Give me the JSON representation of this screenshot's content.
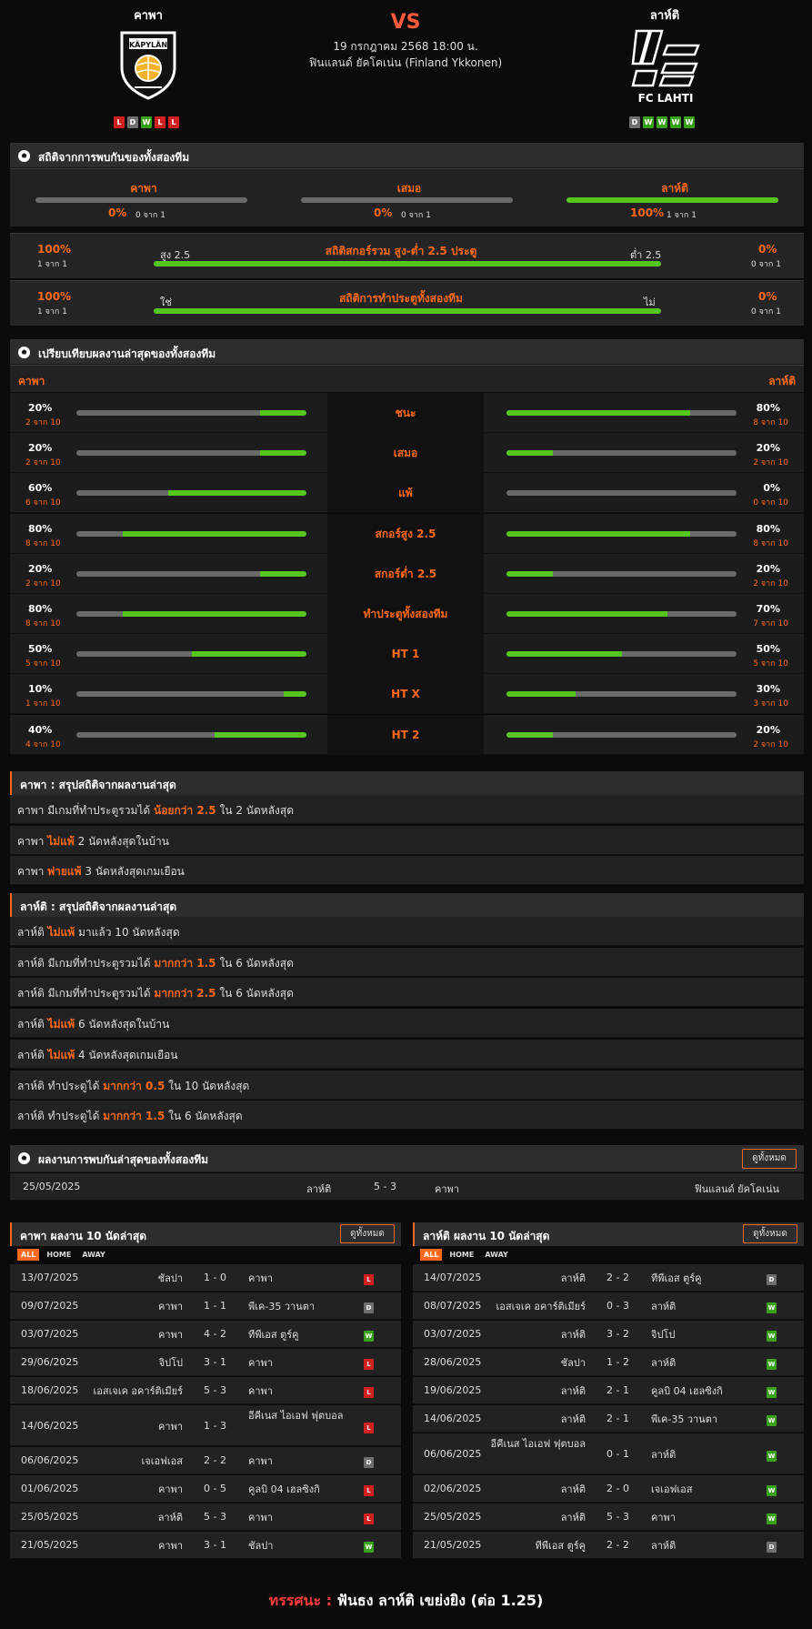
{
  "match": {
    "home": "คาพา",
    "away": "ลาห์ติ",
    "vs": "VS",
    "datetime": "19 กรกฎาคม 2568 18:00 น.",
    "league": "ฟินแลนด์ ยัคโคเน่น (Finland Ykkonen)",
    "home_logo_text": "KÄPYLÄN",
    "away_logo_text": "FC LAHTI",
    "home_form": [
      "L",
      "D",
      "W",
      "L",
      "L"
    ],
    "away_form": [
      "D",
      "W",
      "W",
      "W",
      "W"
    ]
  },
  "h2h": {
    "title": "สถิติจากการพบกันของทั้งสองทีม",
    "cols": [
      {
        "label": "คาพา",
        "pct": "0%",
        "count": "0 จาก 1",
        "fill": 0
      },
      {
        "label": "เสมอ",
        "pct": "0%",
        "count": "0 จาก 1",
        "fill": 0
      },
      {
        "label": "ลาห์ติ",
        "pct": "100%",
        "count": "1 จาก 1",
        "fill": 1
      }
    ],
    "ou": {
      "title": "สถิติสกอร์รวม สูง-ต่ำ 2.5 ประตู",
      "left_tag": "สูง 2.5",
      "right_tag": "ต่ำ 2.5",
      "left_pct": "100%",
      "left_count": "1 จาก 1",
      "right_pct": "0%",
      "right_count": "0 จาก 1",
      "fill": 1
    },
    "btts": {
      "title": "สถิติการทำประตูทั้งสองทีม",
      "left_tag": "ใช่",
      "right_tag": "ไม่",
      "left_pct": "100%",
      "left_count": "1 จาก 1",
      "right_pct": "0%",
      "right_count": "0 จาก 1",
      "fill": 1
    }
  },
  "compare": {
    "title": "เปรียบเทียบผลงานล่าสุดของทั้งสองทีม",
    "home": "คาพา",
    "away": "ลาห์ติ",
    "rows": [
      {
        "label": "ชนะ",
        "h_pct": "20%",
        "h_cnt": "2 จาก 10",
        "h": 0.2,
        "a_pct": "80%",
        "a_cnt": "8 จาก 10",
        "a": 0.8
      },
      {
        "label": "เสมอ",
        "h_pct": "20%",
        "h_cnt": "2 จาก 10",
        "h": 0.2,
        "a_pct": "20%",
        "a_cnt": "2 จาก 10",
        "a": 0.2
      },
      {
        "label": "แพ้",
        "h_pct": "60%",
        "h_cnt": "6 จาก 10",
        "h": 0.6,
        "a_pct": "0%",
        "a_cnt": "0 จาก 10",
        "a": 0
      },
      {
        "label": "สกอร์สูง 2.5",
        "h_pct": "80%",
        "h_cnt": "8 จาก 10",
        "h": 0.8,
        "a_pct": "80%",
        "a_cnt": "8 จาก 10",
        "a": 0.8
      },
      {
        "label": "สกอร์ต่ำ 2.5",
        "h_pct": "20%",
        "h_cnt": "2 จาก 10",
        "h": 0.2,
        "a_pct": "20%",
        "a_cnt": "2 จาก 10",
        "a": 0.2
      },
      {
        "label": "ทำประตูทั้งสองทีม",
        "h_pct": "80%",
        "h_cnt": "8 จาก 10",
        "h": 0.8,
        "a_pct": "70%",
        "a_cnt": "7 จาก 10",
        "a": 0.7
      },
      {
        "label": "HT 1",
        "h_pct": "50%",
        "h_cnt": "5 จาก 10",
        "h": 0.5,
        "a_pct": "50%",
        "a_cnt": "5 จาก 10",
        "a": 0.5
      },
      {
        "label": "HT X",
        "h_pct": "10%",
        "h_cnt": "1 จาก 10",
        "h": 0.1,
        "a_pct": "30%",
        "a_cnt": "3 จาก 10",
        "a": 0.3
      },
      {
        "label": "HT 2",
        "h_pct": "40%",
        "h_cnt": "4 จาก 10",
        "h": 0.4,
        "a_pct": "20%",
        "a_cnt": "2 จาก 10",
        "a": 0.2
      }
    ]
  },
  "home_summary": {
    "title": "คาพา : สรุปสถิติจากผลงานล่าสุด",
    "rows": [
      [
        {
          "t": "คาพา มีเกมที่ทำประตูรวมได้ "
        },
        {
          "t": "น้อยกว่า 2.5",
          "hl": true
        },
        {
          "t": " ใน 2 นัดหลังสุด"
        }
      ],
      [
        {
          "t": "คาพา "
        },
        {
          "t": "ไม่แพ้",
          "hl": true
        },
        {
          "t": " 2 นัดหลังสุดในบ้าน"
        }
      ],
      [
        {
          "t": "คาพา "
        },
        {
          "t": "พ่ายแพ้",
          "hl": true
        },
        {
          "t": " 3 นัดหลังสุดเกมเยือน"
        }
      ]
    ]
  },
  "away_summary": {
    "title": "ลาห์ติ : สรุปสถิติจากผลงานล่าสุด",
    "rows": [
      [
        {
          "t": "ลาห์ติ "
        },
        {
          "t": "ไม่แพ้",
          "hl": true
        },
        {
          "t": " มาแล้ว 10 นัดหลังสุด"
        }
      ],
      [
        {
          "t": "ลาห์ติ มีเกมที่ทำประตูรวมได้ "
        },
        {
          "t": "มากกว่า 1.5",
          "hl": true
        },
        {
          "t": " ใน 6 นัดหลังสุด"
        }
      ],
      [
        {
          "t": "ลาห์ติ มีเกมที่ทำประตูรวมได้ "
        },
        {
          "t": "มากกว่า 2.5",
          "hl": true
        },
        {
          "t": " ใน 6 นัดหลังสุด"
        }
      ],
      [
        {
          "t": "ลาห์ติ "
        },
        {
          "t": "ไม่แพ้",
          "hl": true
        },
        {
          "t": " 6 นัดหลังสุดในบ้าน"
        }
      ],
      [
        {
          "t": "ลาห์ติ "
        },
        {
          "t": "ไม่แพ้",
          "hl": true
        },
        {
          "t": " 4 นัดหลังสุดเกมเยือน"
        }
      ],
      [
        {
          "t": "ลาห์ติ ทำประตูได้ "
        },
        {
          "t": "มากกว่า 0.5",
          "hl": true
        },
        {
          "t": " ใน 10 นัดหลังสุด"
        }
      ],
      [
        {
          "t": "ลาห์ติ ทำประตูได้ "
        },
        {
          "t": "มากกว่า 1.5",
          "hl": true
        },
        {
          "t": " ใน 6 นัดหลังสุด"
        }
      ]
    ]
  },
  "h2h_results": {
    "title": "ผลงานการพบกันล่าสุดของทั้งสองทีม",
    "view_all": "ดูทั้งหมด",
    "rows": [
      {
        "date": "25/05/2025",
        "home": "ลาห์ติ",
        "score": "5 - 3",
        "away": "คาพา",
        "league": "ฟินแลนด์ ยัคโคเน่น"
      }
    ]
  },
  "home_last10": {
    "title": "คาพา ผลงาน 10 นัดล่าสุด",
    "view_all": "ดูทั้งหมด",
    "tabs": [
      "ALL",
      "HOME",
      "AWAY"
    ],
    "rows": [
      {
        "date": "13/07/2025",
        "home": "ชัลปา",
        "score": "1 - 0",
        "away": "คาพา",
        "res": "L"
      },
      {
        "date": "09/07/2025",
        "home": "คาพา",
        "score": "1 - 1",
        "away": "พีเค-35 วานตา",
        "res": "D"
      },
      {
        "date": "03/07/2025",
        "home": "คาพา",
        "score": "4 - 2",
        "away": "ทีพีเอส ตูร์คู",
        "res": "W"
      },
      {
        "date": "29/06/2025",
        "home": "จิปโป",
        "score": "3 - 1",
        "away": "คาพา",
        "res": "L"
      },
      {
        "date": "18/06/2025",
        "home": "เอสเจเค อคาร์ติเมียร์",
        "score": "5 - 3",
        "away": "คาพา",
        "res": "L"
      },
      {
        "date": "14/06/2025",
        "home": "คาพา",
        "score": "1 - 3",
        "away": "อีคีเนส ไอเอฟ ฟุตบอล",
        "res": "L",
        "tall": true
      },
      {
        "date": "06/06/2025",
        "home": "เจเอฟเอส",
        "score": "2 - 2",
        "away": "คาพา",
        "res": "D"
      },
      {
        "date": "01/06/2025",
        "home": "คาพา",
        "score": "0 - 5",
        "away": "คูลบิ 04 เฮลซิงกิ",
        "res": "L"
      },
      {
        "date": "25/05/2025",
        "home": "ลาห์ติ",
        "score": "5 - 3",
        "away": "คาพา",
        "res": "L"
      },
      {
        "date": "21/05/2025",
        "home": "คาพา",
        "score": "3 - 1",
        "away": "ชัลปา",
        "res": "W"
      }
    ]
  },
  "away_last10": {
    "title": "ลาห์ติ ผลงาน 10 นัดล่าสุด",
    "view_all": "ดูทั้งหมด",
    "tabs": [
      "ALL",
      "HOME",
      "AWAY"
    ],
    "rows": [
      {
        "date": "14/07/2025",
        "home": "ลาห์ติ",
        "score": "2 - 2",
        "away": "ทีพีเอส ตูร์คู",
        "res": "D"
      },
      {
        "date": "08/07/2025",
        "home": "เอสเจเค อคาร์ติเมียร์",
        "score": "0 - 3",
        "away": "ลาห์ติ",
        "res": "W"
      },
      {
        "date": "03/07/2025",
        "home": "ลาห์ติ",
        "score": "3 - 2",
        "away": "จิปโป",
        "res": "W"
      },
      {
        "date": "28/06/2025",
        "home": "ชัลปา",
        "score": "1 - 2",
        "away": "ลาห์ติ",
        "res": "W"
      },
      {
        "date": "19/06/2025",
        "home": "ลาห์ติ",
        "score": "2 - 1",
        "away": "คูลบิ 04 เฮลซิงกิ",
        "res": "W"
      },
      {
        "date": "14/06/2025",
        "home": "ลาห์ติ",
        "score": "2 - 1",
        "away": "พีเค-35 วานตา",
        "res": "W"
      },
      {
        "date": "06/06/2025",
        "home": "อีคีเนส ไอเอฟ ฟุตบอล",
        "score": "0 - 1",
        "away": "ลาห์ติ",
        "res": "W",
        "tall": true
      },
      {
        "date": "02/06/2025",
        "home": "ลาห์ติ",
        "score": "2 - 0",
        "away": "เจเอฟเอส",
        "res": "W"
      },
      {
        "date": "25/05/2025",
        "home": "ลาห์ติ",
        "score": "5 - 3",
        "away": "คาพา",
        "res": "W"
      },
      {
        "date": "21/05/2025",
        "home": "ทีพีเอส ตูร์คู",
        "score": "2 - 2",
        "away": "ลาห์ติ",
        "res": "D"
      }
    ]
  },
  "prediction": {
    "label": "ทรรศนะ :",
    "text": "ฟันธง ลาห์ติ เขย่งยิง (ต่อ 1.25)"
  },
  "colors": {
    "accent": "#ff6a1a",
    "bar_fill": "#56c61d",
    "bar_bg": "#6a6a6a",
    "vs": "#ff5a3c"
  }
}
